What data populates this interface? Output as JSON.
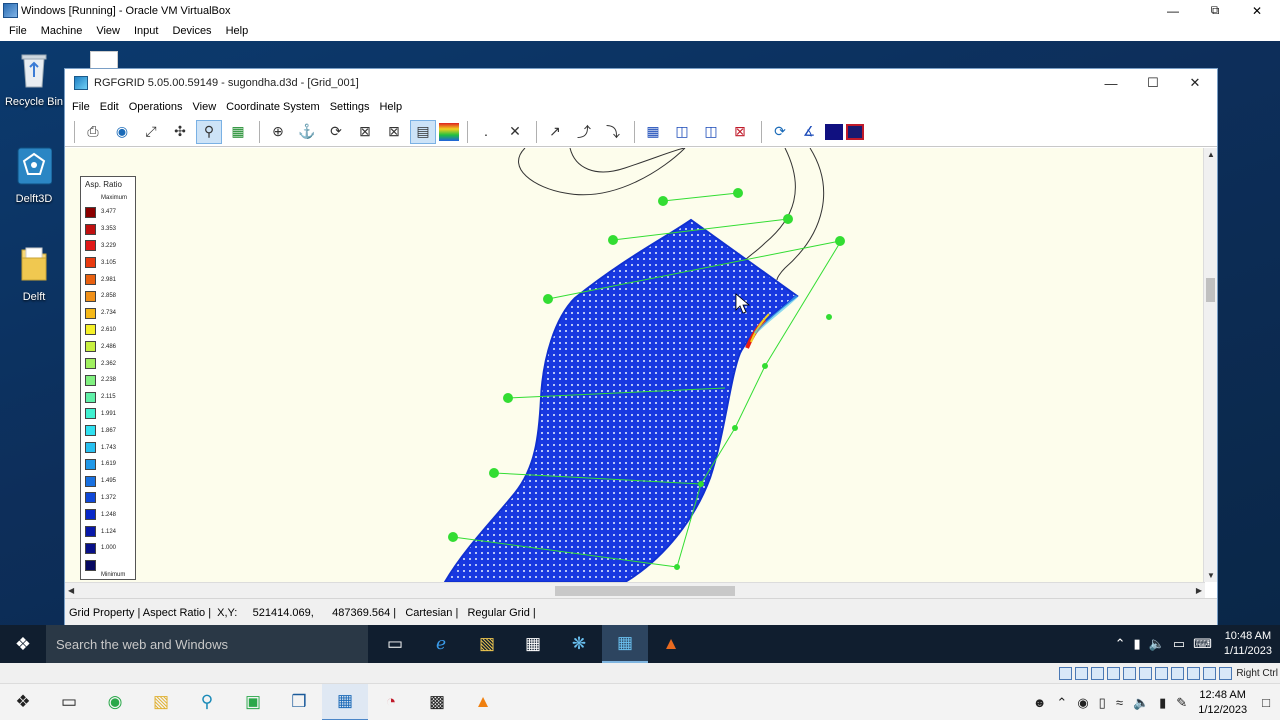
{
  "host_window": {
    "title": "Windows [Running] - Oracle VM VirtualBox",
    "menu": [
      "File",
      "Machine",
      "View",
      "Input",
      "Devices",
      "Help"
    ]
  },
  "desktop": {
    "icons": [
      {
        "label": "Recycle Bin",
        "icon": "recycle-bin-icon"
      },
      {
        "label": "Delft3D",
        "icon": "delft3d-icon"
      },
      {
        "label": "Delft",
        "icon": "folder-icon"
      }
    ]
  },
  "app": {
    "title": "RGFGRID 5.05.00.59149 - sugondha.d3d - [Grid_001]",
    "menu": [
      "File",
      "Edit",
      "Operations",
      "View",
      "Coordinate System",
      "Settings",
      "Help"
    ],
    "toolbar_icons": [
      "print-icon",
      "globe-icon",
      "zoom-extent-icon",
      "zoom-fit-icon",
      "zoom-icon",
      "grid-color-icon",
      "target-icon",
      "anchor-icon",
      "refresh-icon",
      "grid-select-icon",
      "grid-delete-icon",
      "legend-icon",
      "color-scale-icon",
      "spline-point-icon",
      "spline-delete-icon",
      "spline-insert-icon",
      "spline-move-icon",
      "spline-split-icon",
      "grid-block-icon",
      "grid-add-icon",
      "grid-refine-icon",
      "grid-erase-icon",
      "orthogonalise-icon",
      "measure-icon",
      "dark-blue-icon",
      "dark-grid-icon"
    ],
    "legend": {
      "title": "Asp. Ratio",
      "top_label": "Maximum",
      "bottom_label": "Minimum",
      "entries": [
        {
          "value": "3.477",
          "color": "#8b0000"
        },
        {
          "value": "3.353",
          "color": "#c01010"
        },
        {
          "value": "3.229",
          "color": "#e01818"
        },
        {
          "value": "3.105",
          "color": "#e83a10"
        },
        {
          "value": "2.981",
          "color": "#e86010"
        },
        {
          "value": "2.858",
          "color": "#f09018"
        },
        {
          "value": "2.734",
          "color": "#f5b818"
        },
        {
          "value": "2.610",
          "color": "#f5f028"
        },
        {
          "value": "2.486",
          "color": "#c8f040"
        },
        {
          "value": "2.362",
          "color": "#a0f060"
        },
        {
          "value": "2.238",
          "color": "#80f080"
        },
        {
          "value": "2.115",
          "color": "#60f0a8"
        },
        {
          "value": "1.991",
          "color": "#40f0d0"
        },
        {
          "value": "1.867",
          "color": "#30e0f0"
        },
        {
          "value": "1.743",
          "color": "#28c0f0"
        },
        {
          "value": "1.619",
          "color": "#2098e8"
        },
        {
          "value": "1.495",
          "color": "#1870e0"
        },
        {
          "value": "1.372",
          "color": "#1048d8"
        },
        {
          "value": "1.248",
          "color": "#0828c8"
        },
        {
          "value": "1.124",
          "color": "#0818a8"
        },
        {
          "value": "1.000",
          "color": "#081088"
        },
        {
          "value": "",
          "color": "#060860"
        }
      ]
    },
    "status_bar": "Grid Property | Aspect Ratio |  X,Y:     521414.069,      487369.564 |   Cartesian |   Regular Grid |",
    "colors": {
      "canvas_bg": "#fdfdec",
      "grid": "#1030d8",
      "spline_point": "#33dd33"
    }
  },
  "guest_taskbar": {
    "search_placeholder": "Search the web and Windows",
    "apps": [
      "task-view-icon",
      "edge-icon",
      "file-explorer-icon",
      "store-icon",
      "delft3d-icon",
      "rgfgrid-icon",
      "matlab-icon"
    ],
    "time": "10:48 AM",
    "date": "1/11/2023"
  },
  "vbox_status": {
    "host_key": "Right Ctrl"
  },
  "host_taskbar": {
    "apps": [
      "task-view-icon",
      "chrome-icon",
      "file-explorer-icon",
      "search-app-icon",
      "camtasia-icon",
      "virtualbox-icon",
      "rgfgrid-icon",
      "speed-icon",
      "terminal-icon",
      "vlc-icon"
    ],
    "time": "12:48 AM",
    "date": "1/12/2023"
  }
}
